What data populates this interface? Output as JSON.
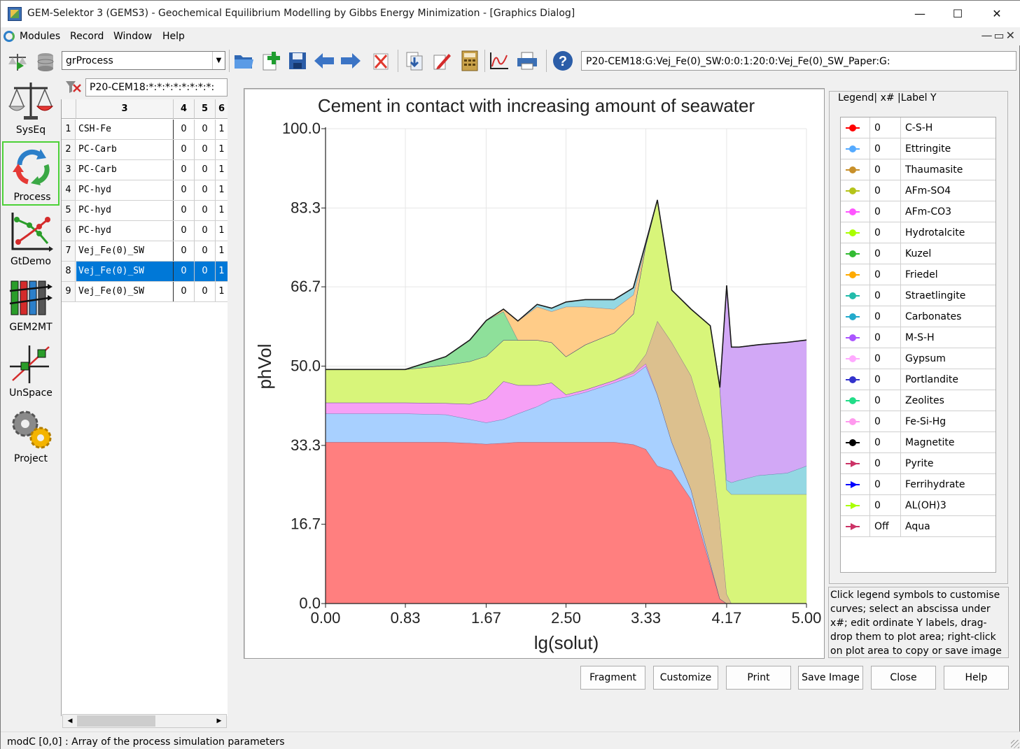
{
  "window": {
    "title": "GEM-Selektor 3 (GEMS3) - Geochemical Equilibrium Modelling by Gibbs Energy Minimization - [Graphics Dialog]",
    "minimize": "—",
    "maximize": "☐",
    "close": "✕"
  },
  "menu": [
    "Modules",
    "Record",
    "Window",
    "Help"
  ],
  "toolbar": {
    "module_combo": "grProcess",
    "icons": [
      "balance-icon",
      "database-icon",
      "open-folder-icon",
      "new-record-icon",
      "save-icon",
      "back-arrow-icon",
      "forward-arrow-icon",
      "delete-icon",
      "import-icon",
      "edit-icon",
      "calculator-icon",
      "graph-icon",
      "print-icon",
      "help-icon"
    ],
    "record_key": "P20-CEM18:G:Vej_Fe(0)_SW:0:0:1:20:0:Vej_Fe(0)_SW_Paper:G:"
  },
  "modules": [
    {
      "label": "SysEq",
      "icon": "balance-scale-icon"
    },
    {
      "label": "Process",
      "icon": "cycle-arrows-icon",
      "selected": true
    },
    {
      "label": "GtDemo",
      "icon": "graph-demo-icon"
    },
    {
      "label": "GEM2MT",
      "icon": "mass-transport-icon"
    },
    {
      "label": "UnSpace",
      "icon": "uncertainty-space-icon"
    },
    {
      "label": "Project",
      "icon": "gears-icon"
    }
  ],
  "record_panel": {
    "key": "P20-CEM18:*:*:*:*:*:*:*:*:",
    "columns": [
      "3",
      "4",
      "5",
      "6"
    ],
    "rows": [
      {
        "n": "1",
        "name": "CSH-Fe",
        "v": [
          "0",
          "0",
          "1"
        ]
      },
      {
        "n": "2",
        "name": "PC-Carb",
        "v": [
          "0",
          "0",
          "1"
        ]
      },
      {
        "n": "3",
        "name": "PC-Carb",
        "v": [
          "0",
          "0",
          "1"
        ]
      },
      {
        "n": "4",
        "name": "PC-hyd",
        "v": [
          "0",
          "0",
          "1"
        ]
      },
      {
        "n": "5",
        "name": "PC-hyd",
        "v": [
          "0",
          "0",
          "1"
        ]
      },
      {
        "n": "6",
        "name": "PC-hyd",
        "v": [
          "0",
          "0",
          "1"
        ]
      },
      {
        "n": "7",
        "name": "Vej_Fe(0)_SW",
        "v": [
          "0",
          "0",
          "1"
        ]
      },
      {
        "n": "8",
        "name": "Vej_Fe(0)_SW",
        "v": [
          "0",
          "0",
          "1"
        ],
        "selected": true
      },
      {
        "n": "9",
        "name": "Vej_Fe(0)_SW",
        "v": [
          "0",
          "0",
          "1"
        ]
      }
    ]
  },
  "chart_data": {
    "type": "area",
    "stacked": true,
    "title": "Cement in contact with increasing amount of seawater",
    "xlabel": "lg(solut)",
    "ylabel": "phVol",
    "xlim": [
      0,
      5
    ],
    "ylim": [
      0,
      100
    ],
    "xticks": [
      "0.00",
      "0.83",
      "1.67",
      "2.50",
      "3.33",
      "4.17",
      "5.00"
    ],
    "yticks": [
      "0.0",
      "16.7",
      "33.3",
      "50.0",
      "66.7",
      "83.3",
      "100.0"
    ],
    "grid": true,
    "x": [
      0,
      0.5,
      0.83,
      1.25,
      1.5,
      1.67,
      1.85,
      2.0,
      2.2,
      2.35,
      2.5,
      2.7,
      3.0,
      3.2,
      3.33,
      3.45,
      3.6,
      3.8,
      4.0,
      4.1,
      4.17,
      4.22,
      4.3,
      4.5,
      4.8,
      5.0
    ],
    "series": [
      {
        "name": "C-S-H",
        "color": "#ff7f7f",
        "values": [
          34.0,
          34.0,
          34.0,
          34.0,
          33.8,
          33.6,
          33.8,
          34.0,
          34.0,
          34.0,
          34.0,
          34.0,
          34.0,
          33.5,
          32.5,
          29.0,
          28.0,
          22.0,
          8.0,
          1.0,
          0,
          0,
          0,
          0,
          0,
          0
        ]
      },
      {
        "name": "Ettringite",
        "color": "#a8d0ff",
        "values": [
          6.0,
          6.0,
          6.0,
          5.8,
          5.0,
          4.5,
          5.0,
          6.0,
          7.5,
          9.0,
          9.5,
          10.5,
          12.5,
          14.5,
          17.5,
          15.0,
          6.0,
          2.0,
          0.5,
          0,
          0,
          0,
          0,
          0,
          0,
          0
        ]
      },
      {
        "name": "AFm-CO3",
        "color": "#f6a0f6",
        "values": [
          2.3,
          2.3,
          2.3,
          2.4,
          3.2,
          5.0,
          8.0,
          6.0,
          4.5,
          3.5,
          0.5,
          0.5,
          0.5,
          0.5,
          0.5,
          0,
          0,
          0,
          0,
          0,
          0,
          0,
          0,
          0,
          0,
          0
        ]
      },
      {
        "name": "Friedel",
        "color": "#dcc08e",
        "values": [
          0,
          0,
          0,
          0,
          0,
          0,
          0,
          0,
          0,
          0,
          0,
          0,
          0,
          0.5,
          2.0,
          15.5,
          21.0,
          24.0,
          26.0,
          16.0,
          2.0,
          0,
          0,
          0,
          0,
          0
        ]
      },
      {
        "name": "Hydrotalcite",
        "color": "#d8f57a",
        "values": [
          7.0,
          7.0,
          7.0,
          8.0,
          9.0,
          9.0,
          8.7,
          9.5,
          9.5,
          8.5,
          8.0,
          9.5,
          10.0,
          12.0,
          23.0,
          25.5,
          11.0,
          14.0,
          24.0,
          28.5,
          22.0,
          23.0,
          23.0,
          23.0,
          23.0,
          23.0
        ]
      },
      {
        "name": "Carbonates",
        "color": "#94d8e3",
        "values": [
          0,
          0,
          0,
          0,
          0,
          0,
          0,
          0,
          0,
          0,
          0,
          0,
          0,
          0,
          0,
          0,
          0,
          0,
          0,
          0,
          2.0,
          2.5,
          3.0,
          4.0,
          4.5,
          6.0
        ]
      },
      {
        "name": "M-S-H",
        "color": "#d2a8f6",
        "values": [
          0,
          0,
          0,
          0,
          0,
          0,
          0,
          0,
          0,
          0,
          0,
          0,
          0,
          0,
          0,
          0,
          0,
          0,
          0,
          0,
          41.0,
          28.5,
          28.0,
          27.5,
          27.5,
          26.5
        ]
      },
      {
        "name": "Kuzel",
        "color": "#8ee09a",
        "values": [
          0,
          0,
          0,
          1.8,
          4.5,
          7.5,
          6.0,
          0,
          0,
          0,
          0,
          0,
          0,
          0,
          0,
          0,
          0,
          0,
          0,
          0,
          0,
          0,
          0,
          0,
          0,
          0
        ]
      },
      {
        "name": "Straetlingite",
        "color": "#ffcc88",
        "values": [
          0,
          0,
          0,
          0,
          0,
          0,
          0.5,
          4.0,
          7.0,
          6.5,
          10.5,
          8.0,
          5.0,
          4.0,
          0,
          0,
          0,
          0,
          0,
          0,
          0,
          0,
          0,
          0,
          0,
          0
        ]
      },
      {
        "name": "Gypsum",
        "color": "#94d8e3",
        "values": [
          0,
          0,
          0,
          0,
          0,
          0,
          0,
          0,
          0.5,
          0.7,
          1.0,
          1.5,
          2.0,
          1.5,
          0.5,
          0,
          0,
          0,
          0,
          0,
          0,
          0,
          0,
          0,
          0,
          0
        ]
      }
    ]
  },
  "legend": {
    "title": "Legend| x# |Label Y",
    "items": [
      {
        "x": "0",
        "label": "C-S-H",
        "color": "#ff0000",
        "marker": "dot"
      },
      {
        "x": "0",
        "label": "Ettringite",
        "color": "#55aaff",
        "marker": "dot"
      },
      {
        "x": "0",
        "label": "Thaumasite",
        "color": "#c8902a",
        "marker": "dot"
      },
      {
        "x": "0",
        "label": "AFm-SO4",
        "color": "#b5c41a",
        "marker": "dot"
      },
      {
        "x": "0",
        "label": "AFm-CO3",
        "color": "#ff55ff",
        "marker": "dot"
      },
      {
        "x": "0",
        "label": "Hydrotalcite",
        "color": "#aaff00",
        "marker": "dot"
      },
      {
        "x": "0",
        "label": "Kuzel",
        "color": "#33bb33",
        "marker": "dot"
      },
      {
        "x": "0",
        "label": "Friedel",
        "color": "#ffaa00",
        "marker": "dot"
      },
      {
        "x": "0",
        "label": "Straetlingite",
        "color": "#22bbaa",
        "marker": "dot"
      },
      {
        "x": "0",
        "label": "Carbonates",
        "color": "#22aacc",
        "marker": "dot"
      },
      {
        "x": "0",
        "label": "M-S-H",
        "color": "#aa55ff",
        "marker": "dot"
      },
      {
        "x": "0",
        "label": "Gypsum",
        "color": "#ffaaff",
        "marker": "dot"
      },
      {
        "x": "0",
        "label": "Portlandite",
        "color": "#3333cc",
        "marker": "dot"
      },
      {
        "x": "0",
        "label": "Zeolites",
        "color": "#22dd88",
        "marker": "dot"
      },
      {
        "x": "0",
        "label": "Fe-Si-Hg",
        "color": "#ff99ee",
        "marker": "dot"
      },
      {
        "x": "0",
        "label": "Magnetite",
        "color": "#000000",
        "marker": "dot"
      },
      {
        "x": "0",
        "label": "Pyrite",
        "color": "#cc3366",
        "marker": "tri"
      },
      {
        "x": "0",
        "label": "Ferrihydrate",
        "color": "#0000ff",
        "marker": "tri"
      },
      {
        "x": "0",
        "label": "AL(OH)3",
        "color": "#aaff00",
        "marker": "tri"
      },
      {
        "x": "Off",
        "label": "Aqua",
        "color": "#cc3366",
        "marker": "tri"
      }
    ]
  },
  "help_text": "Click legend symbols to customise curves; select an abscissa under x#; edit ordinate Y labels, drag-drop them to plot area; right-click on plot area to copy or save image",
  "buttons": [
    "Fragment",
    "Customize",
    "Print",
    "Save Image",
    "Close",
    "Help"
  ],
  "status": "modC [0,0] : Array of the process simulation parameters"
}
